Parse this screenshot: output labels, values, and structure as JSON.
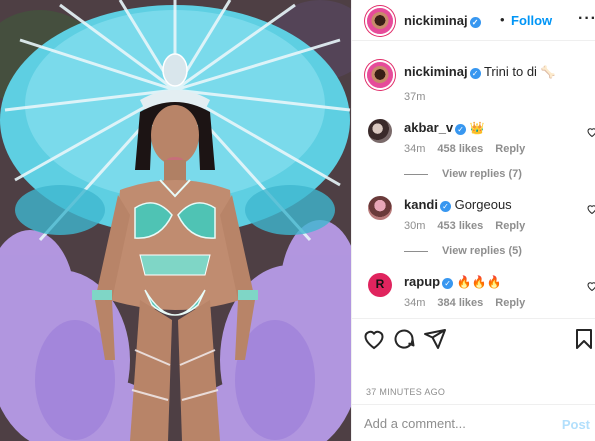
{
  "post": {
    "username": "nickiminaj",
    "separator": "•",
    "follow_label": "Follow",
    "more_icon": "more-options-icon"
  },
  "caption": {
    "username": "nickiminaj",
    "text": "Trini to di",
    "emoji": "🦴",
    "time": "37m"
  },
  "comments": [
    {
      "username": "akbar_v",
      "text": "👑",
      "time": "34m",
      "likes": "458 likes",
      "reply": "Reply",
      "view_replies": "View replies (7)"
    },
    {
      "username": "kandi",
      "text": "Gorgeous",
      "time": "30m",
      "likes": "453 likes",
      "reply": "Reply",
      "view_replies": "View replies (5)"
    },
    {
      "username": "rapup",
      "text": "🔥🔥🔥",
      "time": "34m",
      "likes": "384 likes",
      "reply": "Reply"
    }
  ],
  "timestamp": "37 MINUTES AGO",
  "comment_box": {
    "placeholder": "Add a comment...",
    "post_label": "Post"
  },
  "colors": {
    "accent": "#0095f6",
    "verified": "#3897f0",
    "muted": "#8e8e8e",
    "post_disabled": "#b2dffc"
  }
}
